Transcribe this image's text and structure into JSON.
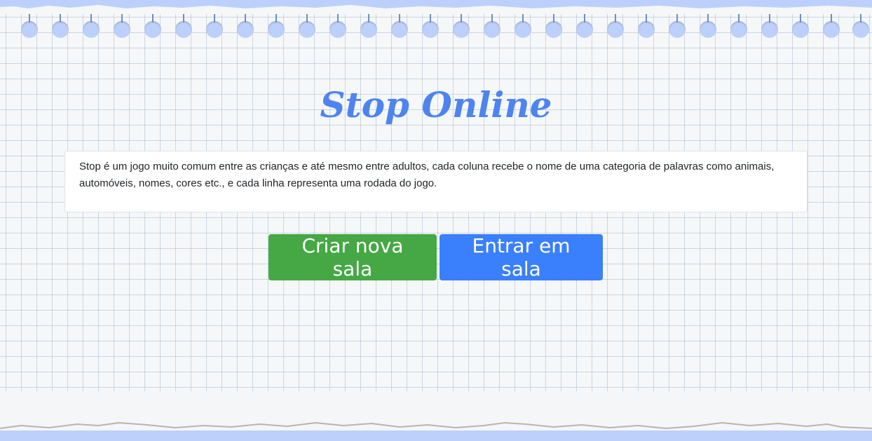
{
  "header": {
    "title": "Stop Online"
  },
  "description": {
    "text": "Stop é um jogo muito comum entre as crianças e até mesmo entre adultos, cada coluna recebe o nome de uma categoria de palavras como animais, automóveis, nomes, cores etc., e cada linha representa uma rodada do jogo."
  },
  "actions": {
    "create_label": "Criar nova sala",
    "join_label": "Entrar em sala"
  },
  "theme": {
    "background": "#bcd0fb",
    "paper": "#f6f7f8",
    "title_color": "#4d84f0",
    "create_color": "#45a844",
    "join_color": "#3a7ffb"
  }
}
